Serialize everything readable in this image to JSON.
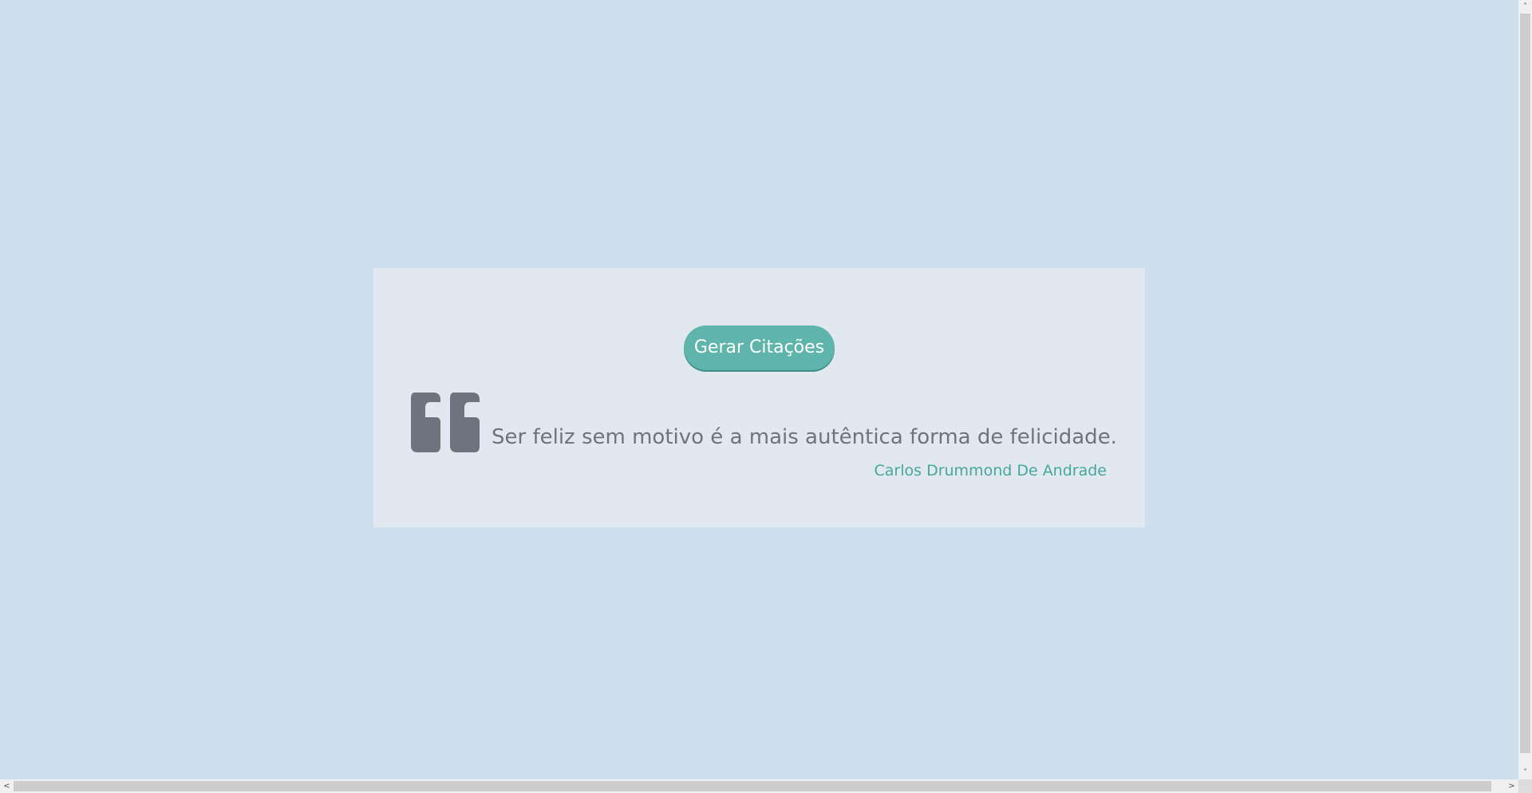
{
  "colors": {
    "page_background": "#cddfec",
    "card_background": "#e1e8ef",
    "button_background": "#5fb4ab",
    "button_text": "#ffffff",
    "quote_text": "#6d7480",
    "author_text": "#46a79d"
  },
  "button": {
    "label": "Gerar Citações"
  },
  "quote": {
    "icon": "quote-left-icon",
    "text": "Ser feliz sem motivo é a mais autêntica forma de felicidade.",
    "author": "Carlos Drummond De Andrade"
  },
  "scrollbars": {
    "vertical": {
      "up_glyph": "˄",
      "down_glyph": "˅"
    },
    "horizontal": {
      "left_glyph": "<",
      "right_glyph": ">"
    }
  }
}
